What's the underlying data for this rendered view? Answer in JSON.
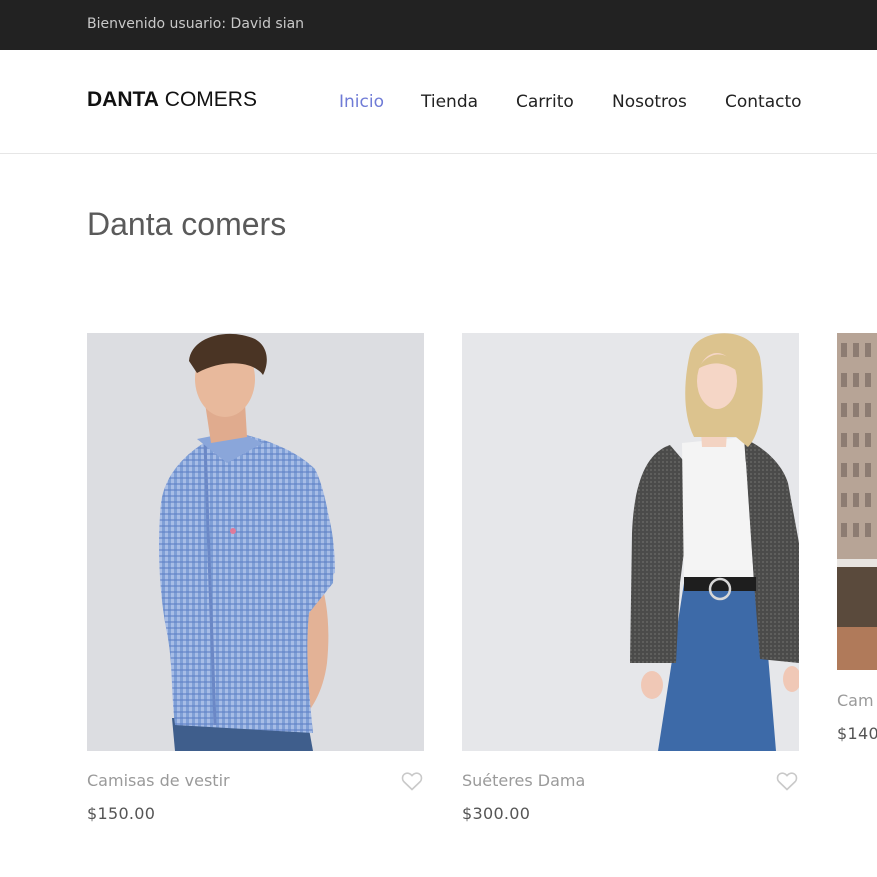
{
  "topbar": {
    "welcome": "Bienvenido usuario: David sian"
  },
  "brand": {
    "bold": "DANTA",
    "light": " COMERS"
  },
  "nav": [
    {
      "label": "Inicio",
      "active": true
    },
    {
      "label": "Tienda",
      "active": false
    },
    {
      "label": "Carrito",
      "active": false
    },
    {
      "label": "Nosotros",
      "active": false
    },
    {
      "label": "Contacto",
      "active": false
    }
  ],
  "page": {
    "title": "Danta comers"
  },
  "products": [
    {
      "name": "Camisas de vestir",
      "price": "$150.00"
    },
    {
      "name": "Suéteres Dama",
      "price": "$300.00"
    },
    {
      "name": "Cam",
      "price": "$140"
    }
  ],
  "colors": {
    "topbar": "#222222",
    "accent": "#6f7bd6"
  },
  "icons": {
    "favorite": "heart-outline-icon"
  }
}
